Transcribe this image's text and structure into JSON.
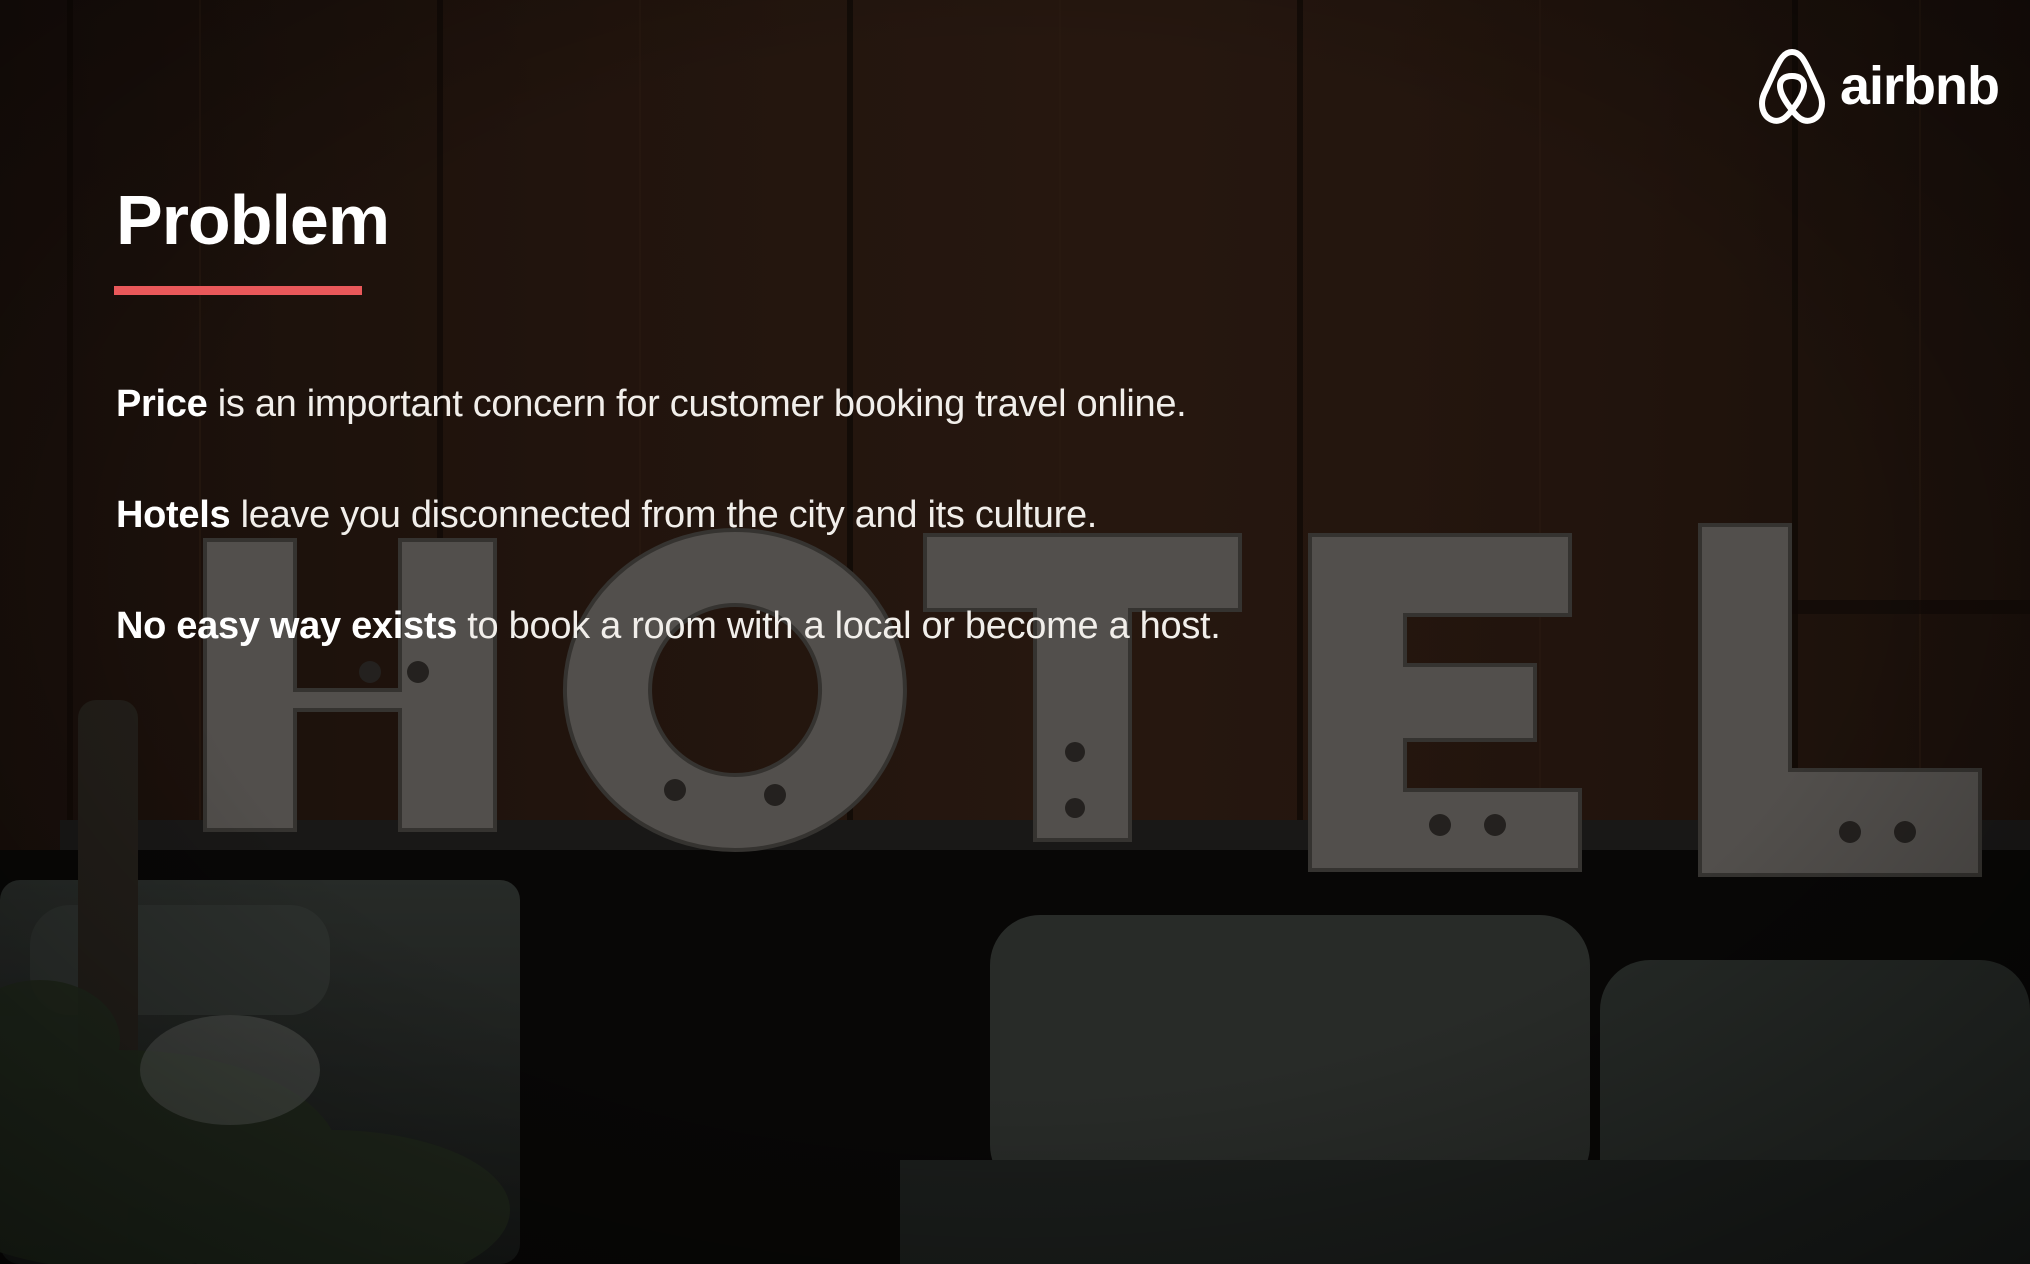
{
  "logo": {
    "icon": "airbnb-belo-icon",
    "text": "airbnb"
  },
  "title": "Problem",
  "accent_color": "#e9585a",
  "points": [
    {
      "bold": "Price",
      "rest": " is an important concern for customer booking travel online."
    },
    {
      "bold": "Hotels",
      "rest": " leave you disconnected from the city and its culture."
    },
    {
      "bold": "No easy way exists",
      "rest": " to book a room with a local or become a host."
    }
  ]
}
